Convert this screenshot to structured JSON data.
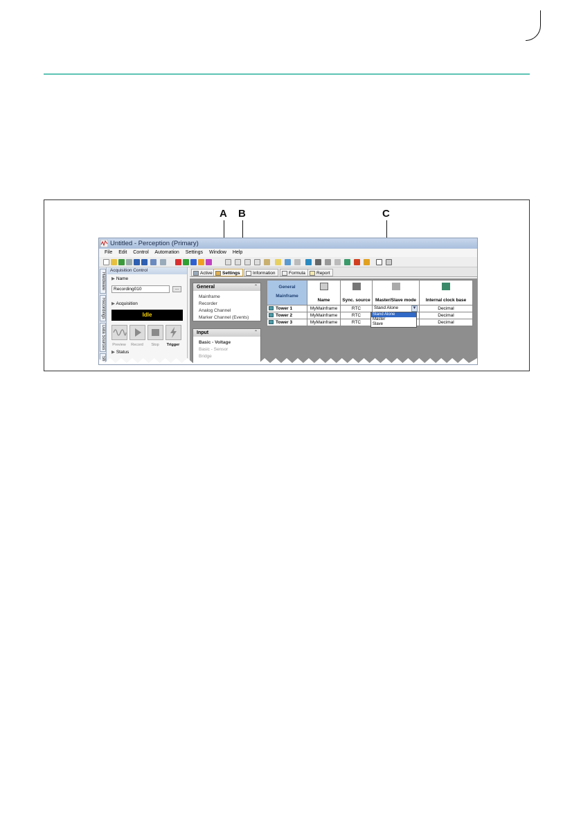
{
  "figure": {
    "callouts": [
      "A",
      "B",
      "C"
    ]
  },
  "app": {
    "title": "Untitled - Perception (Primary)",
    "menu": [
      "File",
      "Edit",
      "Control",
      "Automation",
      "Settings",
      "Window",
      "Help"
    ],
    "side_tabs": [
      "Hardware",
      "Recordings",
      "Data Sources",
      "Sh"
    ],
    "acquisition": {
      "header": "Acquisition Control",
      "name_label": "Name",
      "name_value": "Recording010",
      "browse": "...",
      "acquisition_label": "Acquisition",
      "state": "Idle",
      "buttons": [
        "Preview",
        "Record",
        "Stop",
        "Trigger"
      ],
      "status_label": "Status"
    },
    "workspace_tabs": [
      "Active",
      "Settings",
      "Information",
      "Formula",
      "Report"
    ],
    "active_tab": "Settings",
    "settings_panel": {
      "general": {
        "title": "General",
        "items": [
          "Mainframe",
          "Recorder",
          "Analog Channel",
          "Marker Channel (Events)"
        ]
      },
      "input": {
        "title": "Input",
        "items": [
          "Basic - Voltage",
          "Basic - Sensor",
          "Bridge"
        ]
      }
    },
    "grid": {
      "corner": [
        "General",
        "Mainframe"
      ],
      "columns": [
        "Name",
        "Sync. source",
        "Master/Slave mode",
        "Internal clock base"
      ],
      "rows": [
        {
          "label": "Tower 1",
          "name": "MyMainframe",
          "sync": "RTC",
          "mode": "Stand Alone",
          "clock": "Decimal"
        },
        {
          "label": "Tower 2",
          "name": "MyMainframe",
          "sync": "RTC",
          "mode": "",
          "clock": "Decimal"
        },
        {
          "label": "Tower 3",
          "name": "MyMainframe",
          "sync": "RTC",
          "mode": "",
          "clock": "Decimal"
        }
      ],
      "dropdown_options": [
        "Stand Alone",
        "Master",
        "Slave"
      ],
      "dropdown_selected": "Stand Alone"
    }
  }
}
